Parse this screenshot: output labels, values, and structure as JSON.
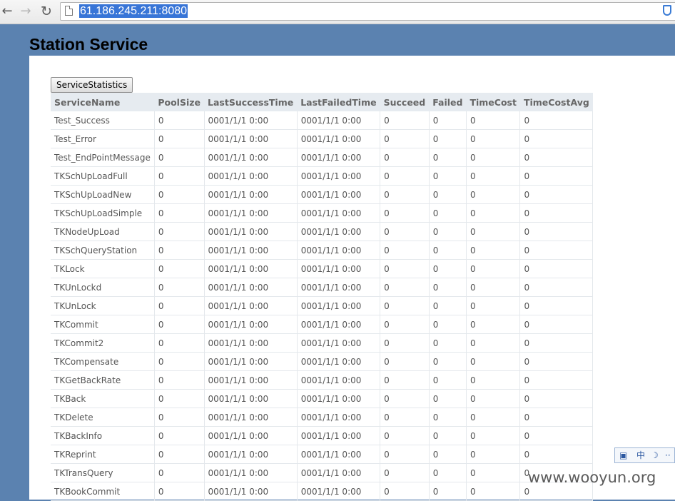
{
  "browser": {
    "url": "61.186.245.211:8080",
    "back_glyph": "←",
    "forward_glyph": "→",
    "reload_glyph": "↻"
  },
  "page": {
    "title": "Station Service",
    "button_label": "ServiceStatistics"
  },
  "table": {
    "headers": [
      "ServiceName",
      "PoolSize",
      "LastSuccessTime",
      "LastFailedTime",
      "Succeed",
      "Failed",
      "TimeCost",
      "TimeCostAvg"
    ],
    "rows": [
      [
        "Test_Success",
        "0",
        "0001/1/1 0:00",
        "0001/1/1 0:00",
        "0",
        "0",
        "0",
        "0"
      ],
      [
        "Test_Error",
        "0",
        "0001/1/1 0:00",
        "0001/1/1 0:00",
        "0",
        "0",
        "0",
        "0"
      ],
      [
        "Test_EndPointMessage",
        "0",
        "0001/1/1 0:00",
        "0001/1/1 0:00",
        "0",
        "0",
        "0",
        "0"
      ],
      [
        "TKSchUpLoadFull",
        "0",
        "0001/1/1 0:00",
        "0001/1/1 0:00",
        "0",
        "0",
        "0",
        "0"
      ],
      [
        "TKSchUpLoadNew",
        "0",
        "0001/1/1 0:00",
        "0001/1/1 0:00",
        "0",
        "0",
        "0",
        "0"
      ],
      [
        "TKSchUpLoadSimple",
        "0",
        "0001/1/1 0:00",
        "0001/1/1 0:00",
        "0",
        "0",
        "0",
        "0"
      ],
      [
        "TKNodeUpLoad",
        "0",
        "0001/1/1 0:00",
        "0001/1/1 0:00",
        "0",
        "0",
        "0",
        "0"
      ],
      [
        "TKSchQueryStation",
        "0",
        "0001/1/1 0:00",
        "0001/1/1 0:00",
        "0",
        "0",
        "0",
        "0"
      ],
      [
        "TKLock",
        "0",
        "0001/1/1 0:00",
        "0001/1/1 0:00",
        "0",
        "0",
        "0",
        "0"
      ],
      [
        "TKUnLockd",
        "0",
        "0001/1/1 0:00",
        "0001/1/1 0:00",
        "0",
        "0",
        "0",
        "0"
      ],
      [
        "TKUnLock",
        "0",
        "0001/1/1 0:00",
        "0001/1/1 0:00",
        "0",
        "0",
        "0",
        "0"
      ],
      [
        "TKCommit",
        "0",
        "0001/1/1 0:00",
        "0001/1/1 0:00",
        "0",
        "0",
        "0",
        "0"
      ],
      [
        "TKCommit2",
        "0",
        "0001/1/1 0:00",
        "0001/1/1 0:00",
        "0",
        "0",
        "0",
        "0"
      ],
      [
        "TKCompensate",
        "0",
        "0001/1/1 0:00",
        "0001/1/1 0:00",
        "0",
        "0",
        "0",
        "0"
      ],
      [
        "TKGetBackRate",
        "0",
        "0001/1/1 0:00",
        "0001/1/1 0:00",
        "0",
        "0",
        "0",
        "0"
      ],
      [
        "TKBack",
        "0",
        "0001/1/1 0:00",
        "0001/1/1 0:00",
        "0",
        "0",
        "0",
        "0"
      ],
      [
        "TKDelete",
        "0",
        "0001/1/1 0:00",
        "0001/1/1 0:00",
        "0",
        "0",
        "0",
        "0"
      ],
      [
        "TKBackInfo",
        "0",
        "0001/1/1 0:00",
        "0001/1/1 0:00",
        "0",
        "0",
        "0",
        "0"
      ],
      [
        "TKReprint",
        "0",
        "0001/1/1 0:00",
        "0001/1/1 0:00",
        "0",
        "0",
        "0",
        "0"
      ],
      [
        "TKTransQuery",
        "0",
        "0001/1/1 0:00",
        "0001/1/1 0:00",
        "0",
        "0",
        "0",
        "0"
      ],
      [
        "TKBookCommit",
        "0",
        "0001/1/1 0:00",
        "0001/1/1 0:00",
        "0",
        "0",
        "0",
        "0"
      ]
    ]
  },
  "ime_bar": {
    "mode_label": "中",
    "moon_glyph": "☽",
    "dots": "··"
  },
  "watermark": "www.wooyun.org",
  "colors": {
    "page_background": "#5b82b0",
    "header_background": "#e6ebf0",
    "url_highlight": "#3875d7"
  },
  "icons": {
    "page": "page-icon",
    "shield": "shield-icon",
    "ime": "ime-logo-icon"
  }
}
